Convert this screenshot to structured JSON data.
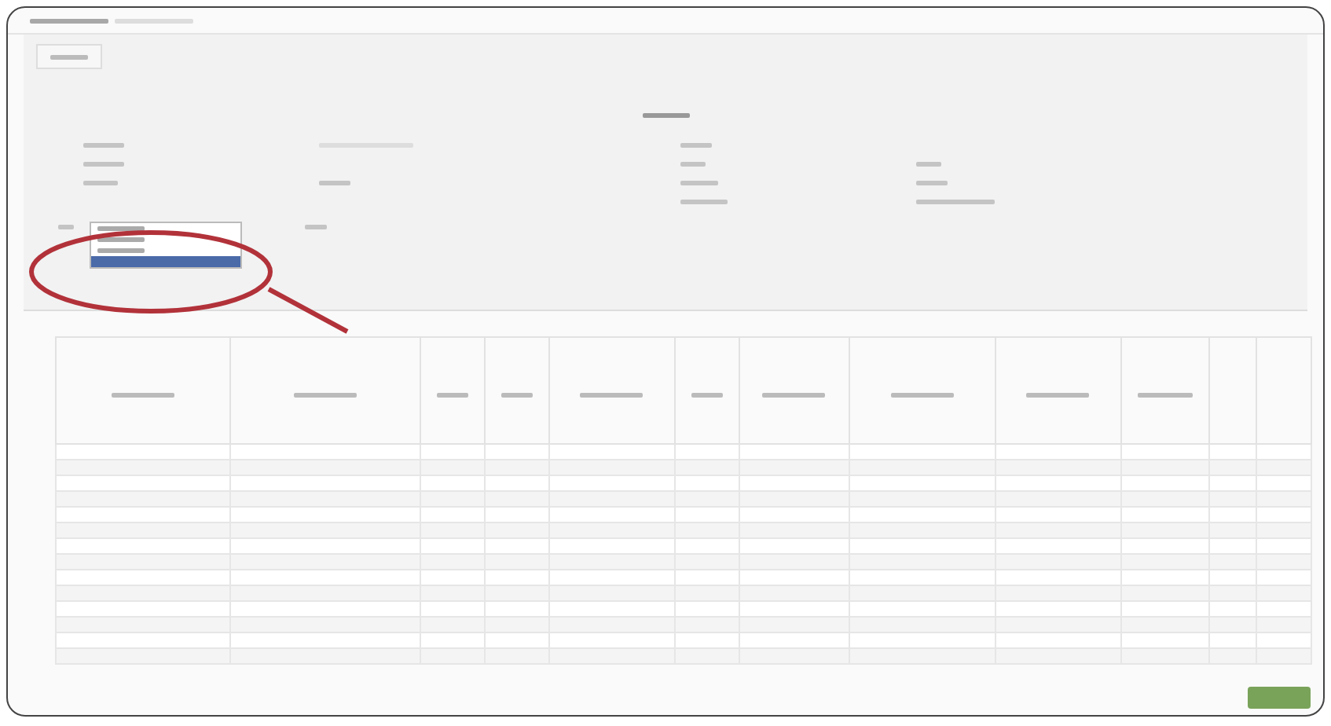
{
  "dropdown": {
    "expanded": true,
    "options": [
      {
        "selected": false
      },
      {
        "selected": false
      },
      {
        "selected": false
      },
      {
        "selected": true
      }
    ]
  },
  "table": {
    "rows": [
      {
        "kind": "blank"
      },
      {
        "kind": "blank"
      },
      {
        "kind": "blank"
      },
      {
        "kind": "blank"
      },
      {
        "kind": "blank"
      },
      {
        "kind": "blank"
      },
      {
        "kind": "blank"
      },
      {
        "kind": "blank"
      },
      {
        "kind": "blank"
      },
      {
        "kind": "blank"
      },
      {
        "kind": "blank"
      },
      {
        "kind": "blank"
      },
      {
        "kind": "blank"
      },
      {
        "kind": "blank"
      }
    ]
  },
  "footer": {
    "button": {
      "kind": "primary"
    }
  }
}
